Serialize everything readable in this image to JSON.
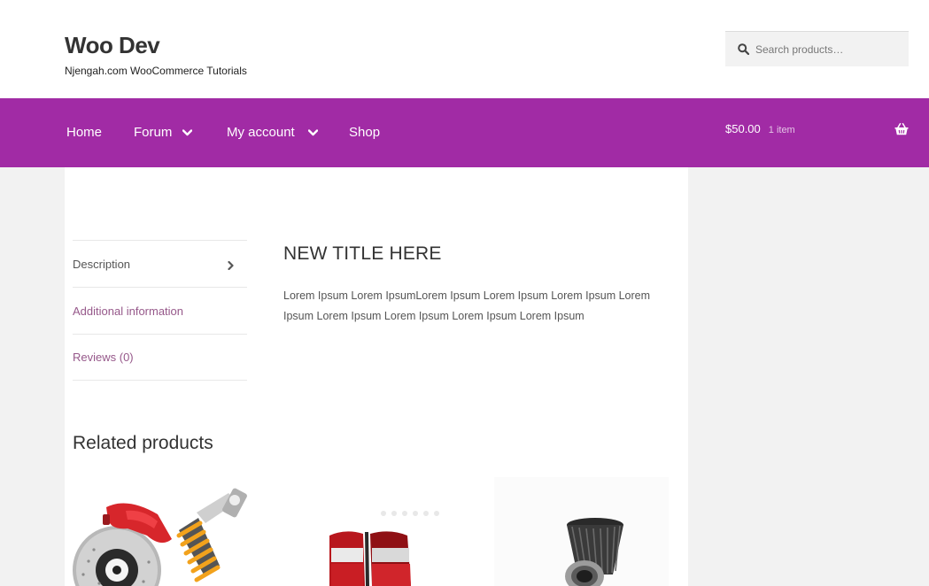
{
  "header": {
    "site_title": "Woo Dev",
    "tagline": "Njengah.com WooCommerce Tutorials",
    "search_placeholder": "Search products…"
  },
  "nav": {
    "items": [
      {
        "label": "Home",
        "has_dropdown": false
      },
      {
        "label": "Forum",
        "has_dropdown": true
      },
      {
        "label": "My account",
        "has_dropdown": true
      },
      {
        "label": "Shop",
        "has_dropdown": false
      }
    ],
    "cart_total": "$50.00",
    "cart_count": "1 item"
  },
  "tabs": [
    {
      "label": "Description",
      "active": true
    },
    {
      "label": "Additional information",
      "active": false
    },
    {
      "label": "Reviews (0)",
      "active": false
    }
  ],
  "panel": {
    "title": "NEW TITLE HERE",
    "text": "Lorem Ipsum Lorem IpsumLorem Ipsum Lorem Ipsum Lorem Ipsum Lorem Ipsum Lorem Ipsum Lorem Ipsum Lorem Ipsum Lorem Ipsum"
  },
  "related": {
    "title": "Related products",
    "products": [
      {
        "icon": "brake-disc-shock-absorber-image"
      },
      {
        "icon": "tail-lights-image"
      },
      {
        "icon": "air-filter-image"
      }
    ]
  },
  "colors": {
    "nav_bg": "#a12ba5",
    "link": "#96588a",
    "page_bg": "#f2f2f2"
  }
}
